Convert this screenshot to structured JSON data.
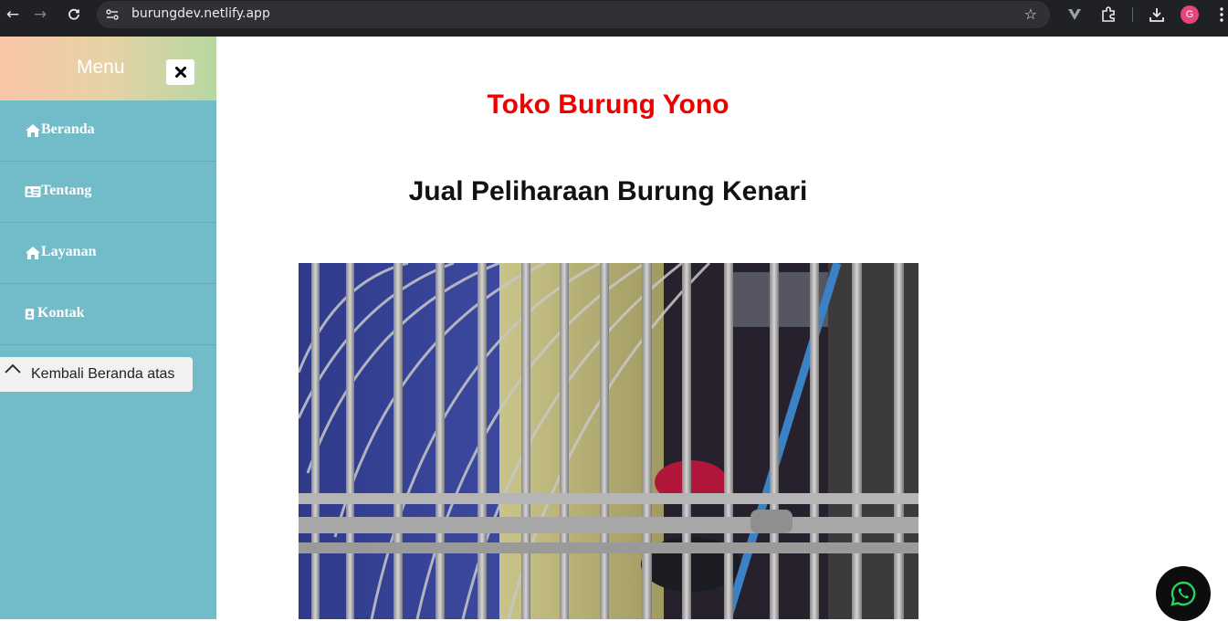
{
  "browser": {
    "url": "burungdev.netlify.app",
    "back_icon": "arrow-left-icon",
    "forward_icon": "arrow-right-icon",
    "reload_icon": "reload-icon",
    "profile_initial": "G"
  },
  "sidebar": {
    "title": "Menu",
    "items": [
      {
        "label": "Beranda",
        "icon": "home-icon"
      },
      {
        "label": "Tentang",
        "icon": "id-card-icon"
      },
      {
        "label": "Layanan",
        "icon": "home-icon"
      },
      {
        "label": "Kontak",
        "icon": "contact-book-icon"
      }
    ],
    "back_to_top": "Kembali Beranda atas"
  },
  "main": {
    "title": "Toko Burung Yono",
    "subtitle": "Jual Peliharaan Burung Kenari"
  },
  "colors": {
    "title_red": "#ee0000",
    "sidebar_bg": "#72bcc9",
    "whatsapp_green": "#25d366"
  }
}
